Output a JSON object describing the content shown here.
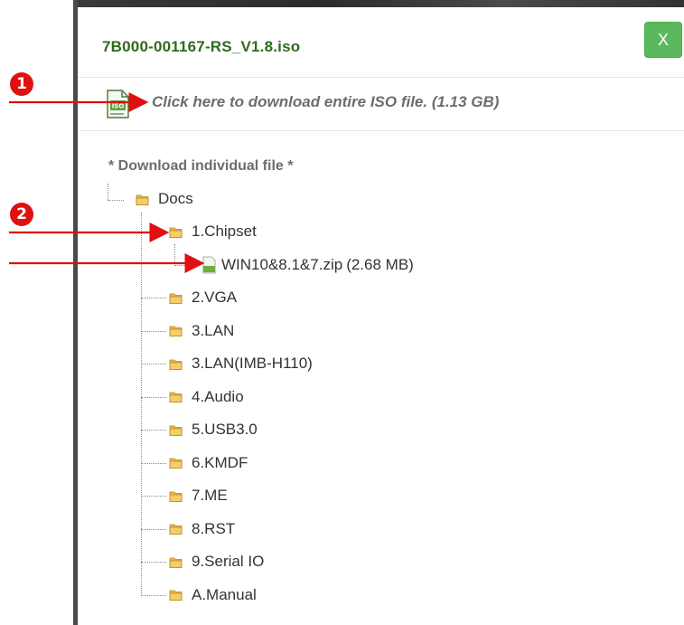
{
  "dialog": {
    "title": "7B000-001167-RS_V1.8.iso",
    "close_label": "X",
    "iso_download_text": "Click here to download entire ISO file. (1.13 GB)",
    "iso_icon_text": "ISO"
  },
  "tree": {
    "section_label": "* Download individual file *",
    "root": "Docs",
    "folders": [
      "1.Chipset",
      "2.VGA",
      "3.LAN",
      "3.LAN(IMB-H110)",
      "4.Audio",
      "5.USB3.0",
      "6.KMDF",
      "7.ME",
      "8.RST",
      "9.Serial IO",
      "A.Manual"
    ],
    "chipset_file": {
      "name": "WIN10&8.1&7.zip",
      "size": "(2.68 MB)"
    }
  },
  "annotations": {
    "badge_1": "1",
    "badge_2": "2"
  },
  "colors": {
    "title_green": "#2f6b1d",
    "close_green": "#5cb85c",
    "annotation_red": "#e01010",
    "folder_gold": "#e8b84a"
  }
}
